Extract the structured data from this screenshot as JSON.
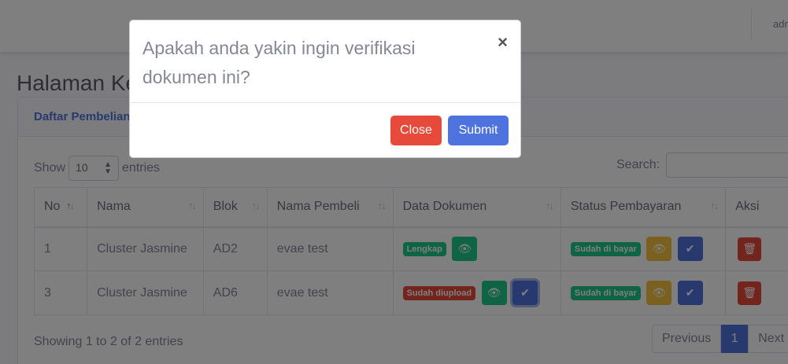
{
  "topbar": {
    "user": "admin"
  },
  "page": {
    "title": "Halaman Kelola Pembelian"
  },
  "card": {
    "header": "Daftar Pembelian"
  },
  "length": {
    "show": "Show",
    "value": "10",
    "entries": "entries"
  },
  "search": {
    "label": "Search:"
  },
  "table": {
    "columns": [
      "No",
      "Nama",
      "Blok",
      "Nama Pembeli",
      "Data Dokumen",
      "Status Pembayaran",
      "Aksi"
    ],
    "rows": [
      {
        "no": "1",
        "nama": "Cluster Jasmine",
        "blok": "AD2",
        "pembeli": "evae test",
        "dokumen": "Lengkap",
        "status": "Sudah di bayar"
      },
      {
        "no": "3",
        "nama": "Cluster Jasmine",
        "blok": "AD6",
        "pembeli": "evae test",
        "dokumen": "Sudah diupload",
        "status": "Sudah di bayar"
      }
    ]
  },
  "info": "Showing 1 to 2 of 2 entries",
  "pagination": {
    "previous": "Previous",
    "current": "1",
    "next": "Next"
  },
  "modal": {
    "title": "Apakah anda yakin ingin verifikasi dokumen ini?",
    "close_icon": "×",
    "close_label": "Close",
    "submit_label": "Submit"
  },
  "icons": {
    "sort": "sort-icon",
    "view": "eye-icon",
    "check": "check-icon",
    "delete": "trash-icon"
  },
  "colors": {
    "primary": "#4e73df",
    "success": "#1cc88a",
    "danger": "#e74a3b",
    "warning": "#f6c23e"
  }
}
